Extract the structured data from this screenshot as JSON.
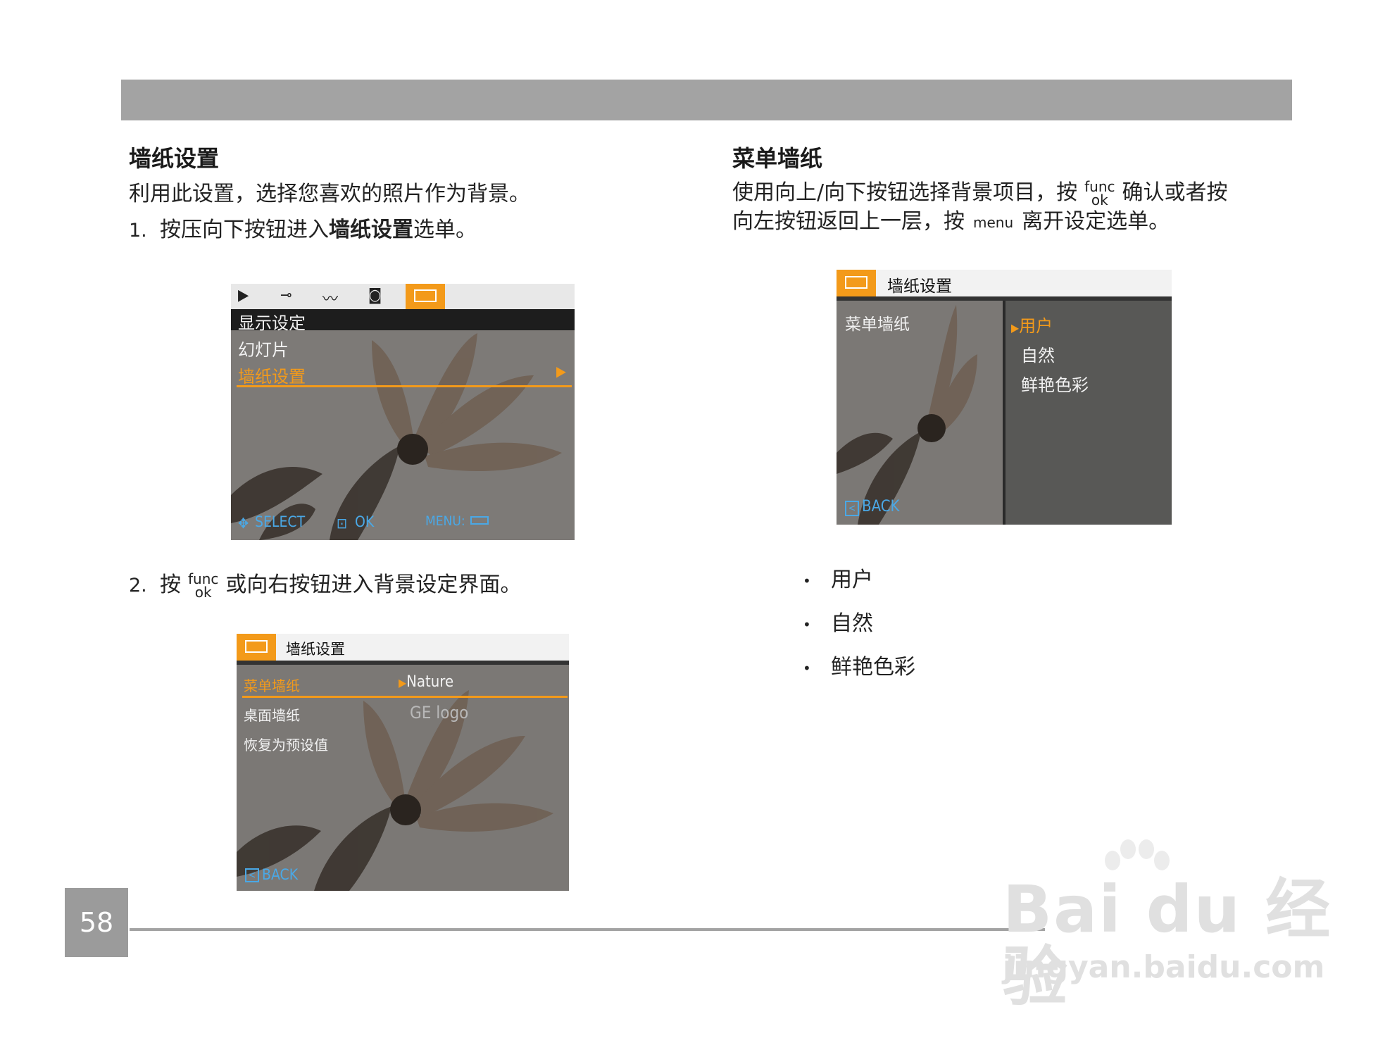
{
  "left": {
    "heading": "墙纸设置",
    "intro": "利用此设置，选择您喜欢的照片作为背景。",
    "step1_num": "1.",
    "step1_pre": "按压向下按钮进入",
    "step1_bold": "墙纸设置",
    "step1_post": "选单。",
    "step2_num": "2.",
    "step2_pre": "按",
    "step2_post": "或向右按钮进入背景设定界面。"
  },
  "right": {
    "heading": "菜单墙纸",
    "line1_pre": "使用向上/向下按钮选择背景项目，按",
    "line1_post": "确认或者按",
    "line2_pre": "向左按钮返回上一层，按",
    "line2_post": "离开设定选单。",
    "bullets": [
      "用户",
      "自然",
      "鲜艳色彩"
    ]
  },
  "keys": {
    "func": "func",
    "ok": "ok",
    "menu": "menu"
  },
  "screen1": {
    "menu_items": [
      "显示设定",
      "幻灯片",
      "墙纸设置"
    ],
    "select": "SELECT",
    "ok": "OK",
    "menu": "MENU:"
  },
  "screen2": {
    "title": "墙纸设置",
    "rows": [
      {
        "label": "菜单墙纸",
        "value": "Nature"
      },
      {
        "label": "桌面墙纸",
        "value": "GE logo"
      },
      {
        "label": "恢复为预设值",
        "value": ""
      }
    ],
    "back": "BACK"
  },
  "screen3": {
    "title": "墙纸设置",
    "left_label": "菜单墙纸",
    "options": [
      "用户",
      "自然",
      "鲜艳色彩"
    ],
    "back": "BACK"
  },
  "page_number": "58",
  "watermark": {
    "brand": "Bai du 经验",
    "url": "jingyan.baidu.com"
  },
  "colors": {
    "accent": "#f39a1a",
    "bar": "#a3a3a3",
    "screen_gray": "#7c7a78"
  }
}
